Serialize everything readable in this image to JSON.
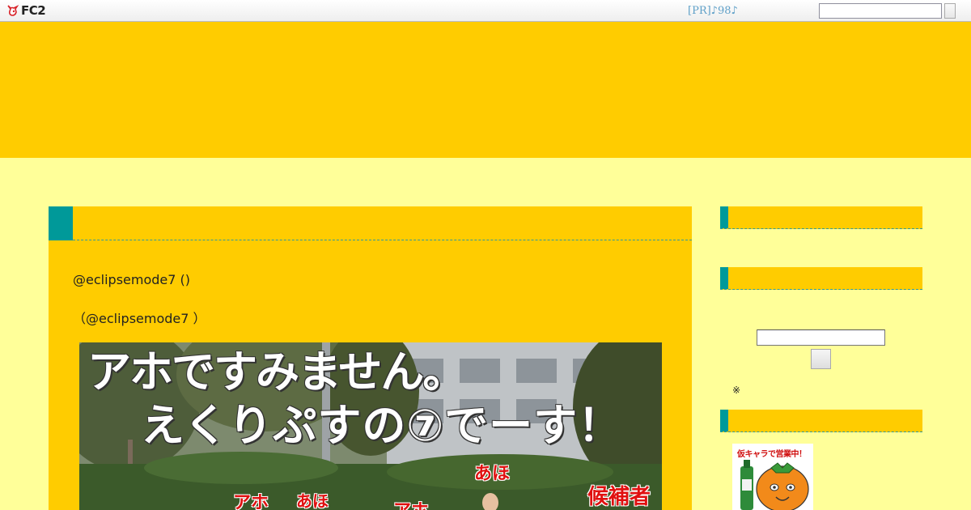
{
  "toolbar": {
    "logo_text": "FC2",
    "pr_link": "[PR]♪98♪",
    "search_value": "",
    "search_button_label": ""
  },
  "entry": {
    "title": "",
    "line1": "@eclipsemode7 ()",
    "line2": "（@eclipsemode7 ）",
    "photo": {
      "caption_line1": "アホですみません。",
      "caption_line2": "えくりぷすの⑦でーす！",
      "tags": [
        "あほ",
        "アホ",
        "あほ",
        "アホ",
        "候補者"
      ]
    }
  },
  "sidebar": {
    "box1_title": "",
    "box2_title": "",
    "search_value": "",
    "search_button_label": "",
    "note": "※",
    "box3_title": "",
    "banner_text": "仮キャラで営業中！"
  },
  "colors": {
    "background": "#ffff99",
    "header": "#ffcc00",
    "accent": "#009999",
    "pr_link": "#5fa0c8",
    "tag_red": "#e01010"
  },
  "icons": [
    "fc2-logo-icon",
    "search-button-icon"
  ]
}
